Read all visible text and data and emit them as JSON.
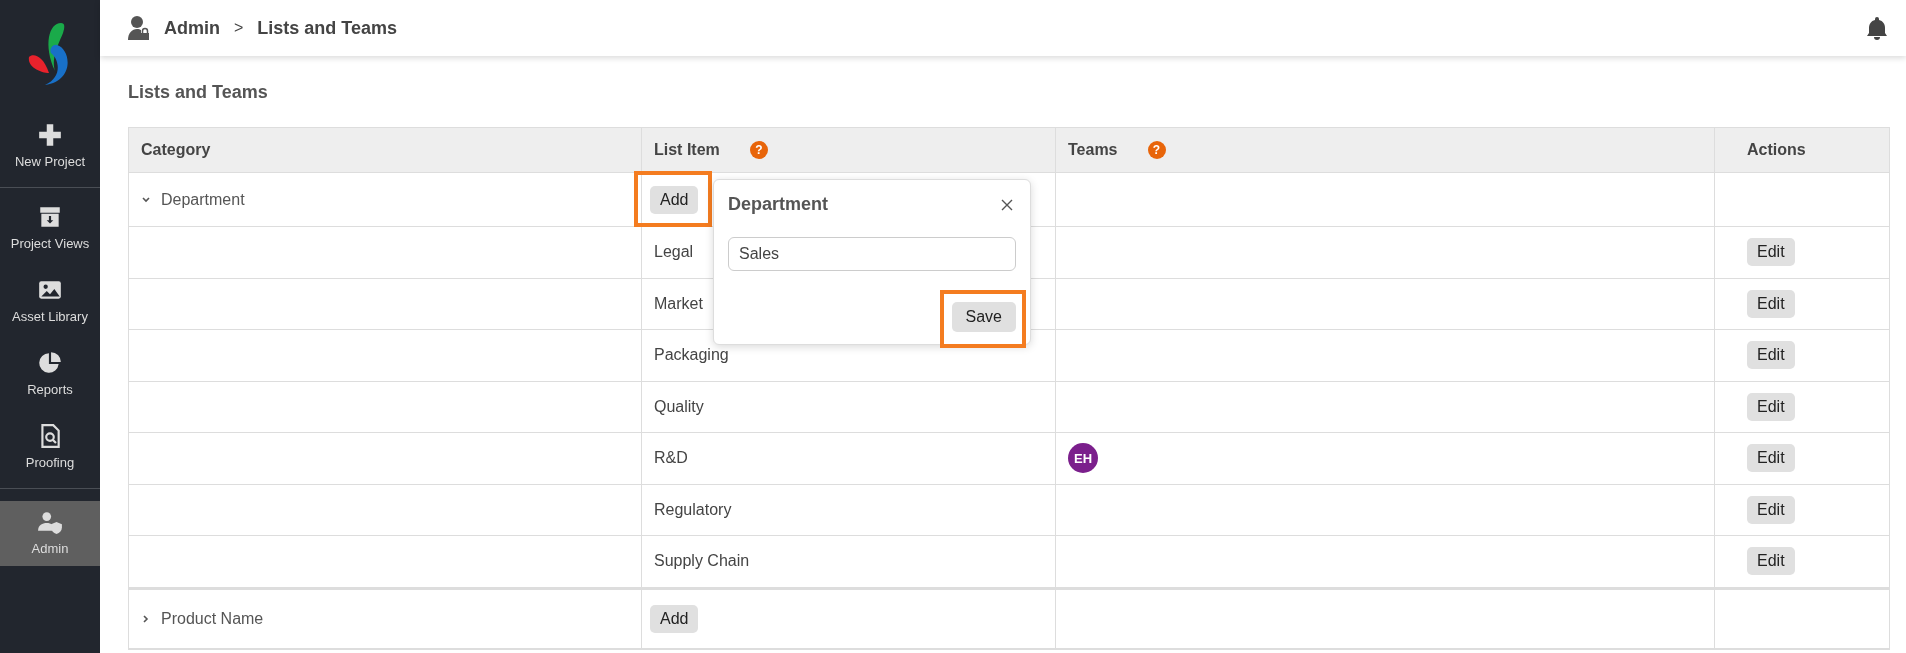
{
  "sidebar": {
    "items": [
      {
        "label": "New Project",
        "selected": false
      },
      {
        "label": "Project Views",
        "selected": false
      },
      {
        "label": "Asset Library",
        "selected": false
      },
      {
        "label": "Reports",
        "selected": false
      },
      {
        "label": "Proofing",
        "selected": false
      },
      {
        "label": "Admin",
        "selected": true
      }
    ]
  },
  "header": {
    "breadcrumb": [
      "Admin",
      "Lists and Teams"
    ],
    "separator": ">"
  },
  "page_title": "Lists and Teams",
  "table": {
    "columns": [
      {
        "label": "Category"
      },
      {
        "label": "List Item",
        "help": "?"
      },
      {
        "label": "Teams",
        "help": "?"
      },
      {
        "label": "Actions"
      }
    ],
    "groups": [
      {
        "category": "Department",
        "expanded": true,
        "add_label": "Add",
        "highlighted": true,
        "items": [
          {
            "name": "Legal",
            "action": "Edit"
          },
          {
            "name": "Market",
            "action": "Edit"
          },
          {
            "name": "Packaging",
            "action": "Edit"
          },
          {
            "name": "Quality",
            "action": "Edit"
          },
          {
            "name": "R&D",
            "teams": [
              {
                "initials": "EH",
                "color": "#7b1f8c"
              }
            ],
            "action": "Edit"
          },
          {
            "name": "Regulatory",
            "action": "Edit"
          },
          {
            "name": "Supply Chain",
            "action": "Edit"
          }
        ]
      },
      {
        "category": "Product Name",
        "expanded": false,
        "add_label": "Add",
        "highlighted": false
      }
    ]
  },
  "popup": {
    "title": "Department",
    "value": "Sales",
    "save_label": "Save",
    "save_highlighted": true
  }
}
